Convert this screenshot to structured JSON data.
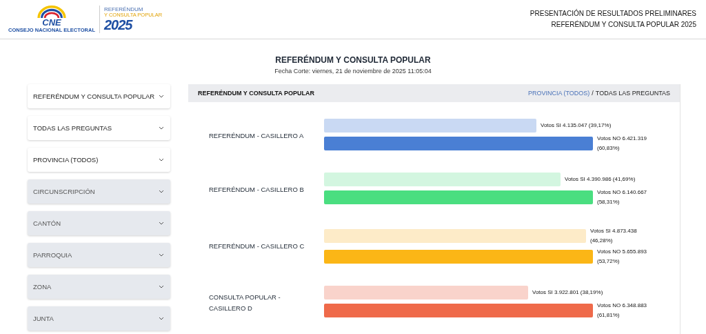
{
  "logo": {
    "cne": "CNE",
    "cne_caption": "CONSEJO NACIONAL ELECTORAL",
    "event_line1": "REFERÉNDUM",
    "event_line2": "Y CONSULTA POPULAR",
    "year": "2025"
  },
  "header": {
    "line1": "PRESENTACIÓN DE RESULTADOS PRELIMINARES",
    "line2": "REFERÉNDUM Y CONSULTA POPULAR 2025"
  },
  "title": "REFERÉNDUM Y CONSULTA POPULAR",
  "cutoff": "Fecha Corte: viernes, 21 de noviembre de 2025 11:05:04",
  "filters": [
    {
      "label": "REFERÉNDUM Y CONSULTA POPULAR",
      "disabled": false
    },
    {
      "label": "TODAS LAS PREGUNTAS",
      "disabled": false
    },
    {
      "label": "PROVINCIA (TODOS)",
      "disabled": false
    },
    {
      "label": "CIRCUNSCRIPCIÓN",
      "disabled": true
    },
    {
      "label": "CANTÓN",
      "disabled": true
    },
    {
      "label": "PARROQUIA",
      "disabled": true
    },
    {
      "label": "ZONA",
      "disabled": true
    },
    {
      "label": "JUNTA",
      "disabled": true
    }
  ],
  "panel": {
    "title": "REFERÉNDUM Y CONSULTA POPULAR",
    "breadcrumb_link": "PROVINCIA (TODOS)",
    "breadcrumb_separator": "/",
    "breadcrumb_current": "TODAS LAS PREGUNTAS"
  },
  "questions": [
    {
      "name": "REFERÉNDUM - CASILLERO A",
      "bars": [
        {
          "label": "Votos SI 4.135.047 (39,17%)",
          "color": "#c9d9f3"
        },
        {
          "label": "Votos NO 6.421.319 (60,83%)",
          "color": "#4a7fd4"
        }
      ]
    },
    {
      "name": "REFERÉNDUM - CASILLERO B",
      "bars": [
        {
          "label": "Votos SI 4.390.986 (41,69%)",
          "color": "#d3f6e0"
        },
        {
          "label": "Votos NO 6.140.667 (58,31%)",
          "color": "#4ade80"
        }
      ]
    },
    {
      "name": "REFERÉNDUM - CASILLERO C",
      "bars": [
        {
          "label": "Votos SI 4.873.438 (46,28%)",
          "color": "#fdebc8"
        },
        {
          "label": "Votos NO 5.655.893 (53,72%)",
          "color": "#fbb616"
        }
      ]
    },
    {
      "name": "CONSULTA POPULAR - CASILLERO D",
      "bars": [
        {
          "label": "Votos SI 3.922.801 (38,19%)",
          "color": "#f9d3cb"
        },
        {
          "label": "Votos NO 6.348.883 (61,81%)",
          "color": "#ef6a4a"
        }
      ]
    }
  ]
}
